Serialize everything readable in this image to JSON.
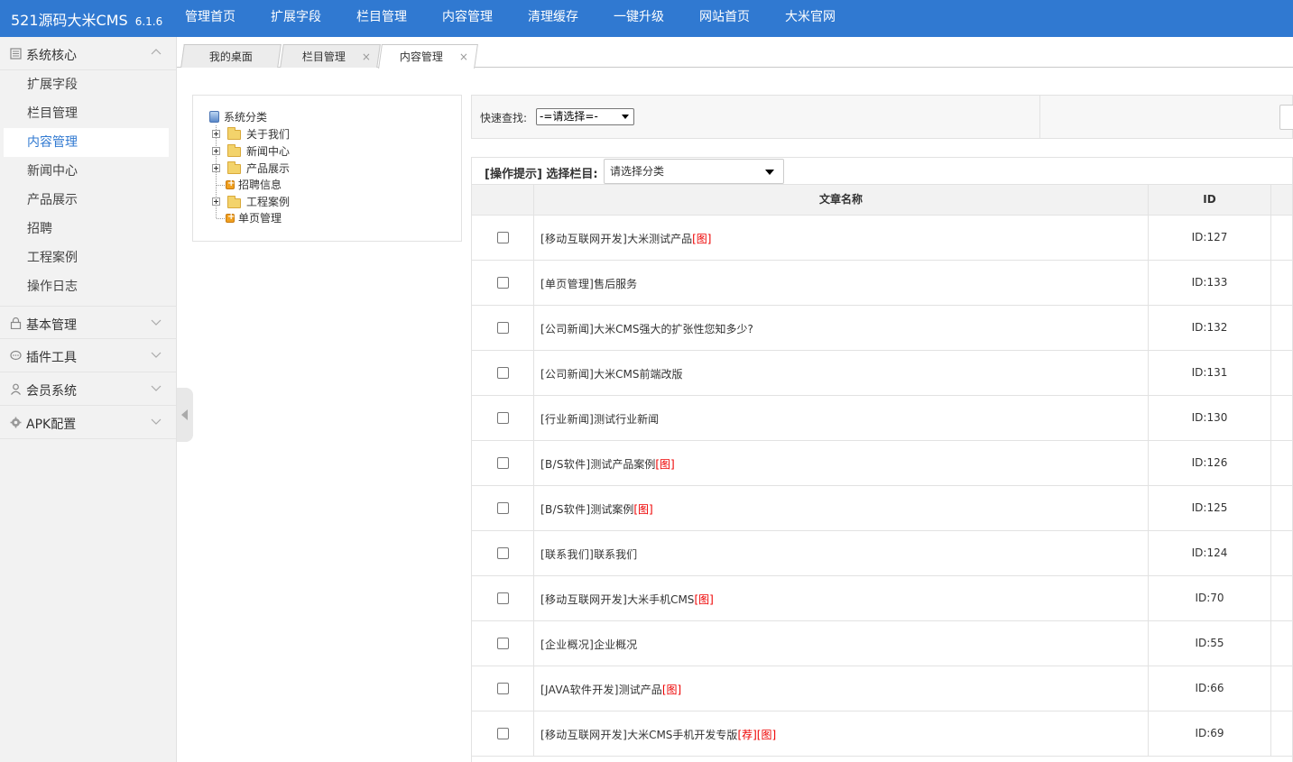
{
  "app": {
    "brand": "521源码大米CMS",
    "version": "6.1.6",
    "topnav": [
      "管理首页",
      "扩展字段",
      "栏目管理",
      "内容管理",
      "清理缓存",
      "一键升级",
      "网站首页",
      "大米官网"
    ]
  },
  "sidebar": {
    "groups": [
      {
        "label": "系统核心",
        "icon": "list-icon",
        "expanded": true
      },
      {
        "label": "基本管理",
        "icon": "lock-icon",
        "expanded": false
      },
      {
        "label": "插件工具",
        "icon": "chat-icon",
        "expanded": false
      },
      {
        "label": "会员系统",
        "icon": "user-icon",
        "expanded": false
      },
      {
        "label": "APK配置",
        "icon": "gear-icon",
        "expanded": false
      }
    ],
    "core_items": [
      "扩展字段",
      "栏目管理",
      "内容管理",
      "新闻中心",
      "产品展示",
      "招聘",
      "工程案例",
      "操作日志"
    ],
    "active_item": "内容管理"
  },
  "tabs": [
    {
      "label": "我的桌面",
      "closable": false,
      "active": false
    },
    {
      "label": "栏目管理",
      "closable": true,
      "active": false
    },
    {
      "label": "内容管理",
      "closable": true,
      "active": true
    }
  ],
  "close_glyph": "×",
  "tree": {
    "root": "系统分类",
    "nodes": [
      {
        "label": "关于我们",
        "type": "folder"
      },
      {
        "label": "新闻中心",
        "type": "folder"
      },
      {
        "label": "产品展示",
        "type": "folder"
      },
      {
        "label": "招聘信息",
        "type": "page"
      },
      {
        "label": "工程案例",
        "type": "folder"
      },
      {
        "label": "单页管理",
        "type": "page"
      }
    ]
  },
  "search": {
    "label": "快速查找:",
    "select_value": "-=请选择=-"
  },
  "table": {
    "tip_label": "[操作提示] 选择栏目:",
    "category_select": "请选择分类",
    "columns": [
      "文章名称",
      "ID"
    ],
    "rows": [
      {
        "cat": "[移动互联网开发]",
        "title": "大米测试产品",
        "tags": "[图]",
        "id": "ID:127"
      },
      {
        "cat": "[单页管理]",
        "title": "售后服务",
        "tags": "",
        "id": "ID:133"
      },
      {
        "cat": "[公司新闻]",
        "title": "大米CMS强大的扩张性您知多少?",
        "tags": "",
        "id": "ID:132"
      },
      {
        "cat": "[公司新闻]",
        "title": "大米CMS前端改版",
        "tags": "",
        "id": "ID:131"
      },
      {
        "cat": "[行业新闻]",
        "title": "测试行业新闻",
        "tags": "",
        "id": "ID:130"
      },
      {
        "cat": "[B/S软件]",
        "title": "测试产品案例",
        "tags": "[图]",
        "id": "ID:126"
      },
      {
        "cat": "[B/S软件]",
        "title": "测试案例",
        "tags": "[图]",
        "id": "ID:125"
      },
      {
        "cat": "[联系我们]",
        "title": "联系我们",
        "tags": "",
        "id": "ID:124"
      },
      {
        "cat": "[移动互联网开发]",
        "title": "大米手机CMS",
        "tags": "[图]",
        "id": "ID:70"
      },
      {
        "cat": "[企业概况]",
        "title": "企业概况",
        "tags": "",
        "id": "ID:55"
      },
      {
        "cat": "[JAVA软件开发]",
        "title": "测试产品",
        "tags": "[图]",
        "id": "ID:66"
      },
      {
        "cat": "[移动互联网开发]",
        "title": "大米CMS手机开发专版",
        "tags": "[荐][图]",
        "id": "ID:69"
      }
    ]
  },
  "colors": {
    "topbar": "#3079d1",
    "active_text": "#3079d1",
    "tag_red": "#e00000",
    "sidebar_bg": "#f2f2f2"
  }
}
